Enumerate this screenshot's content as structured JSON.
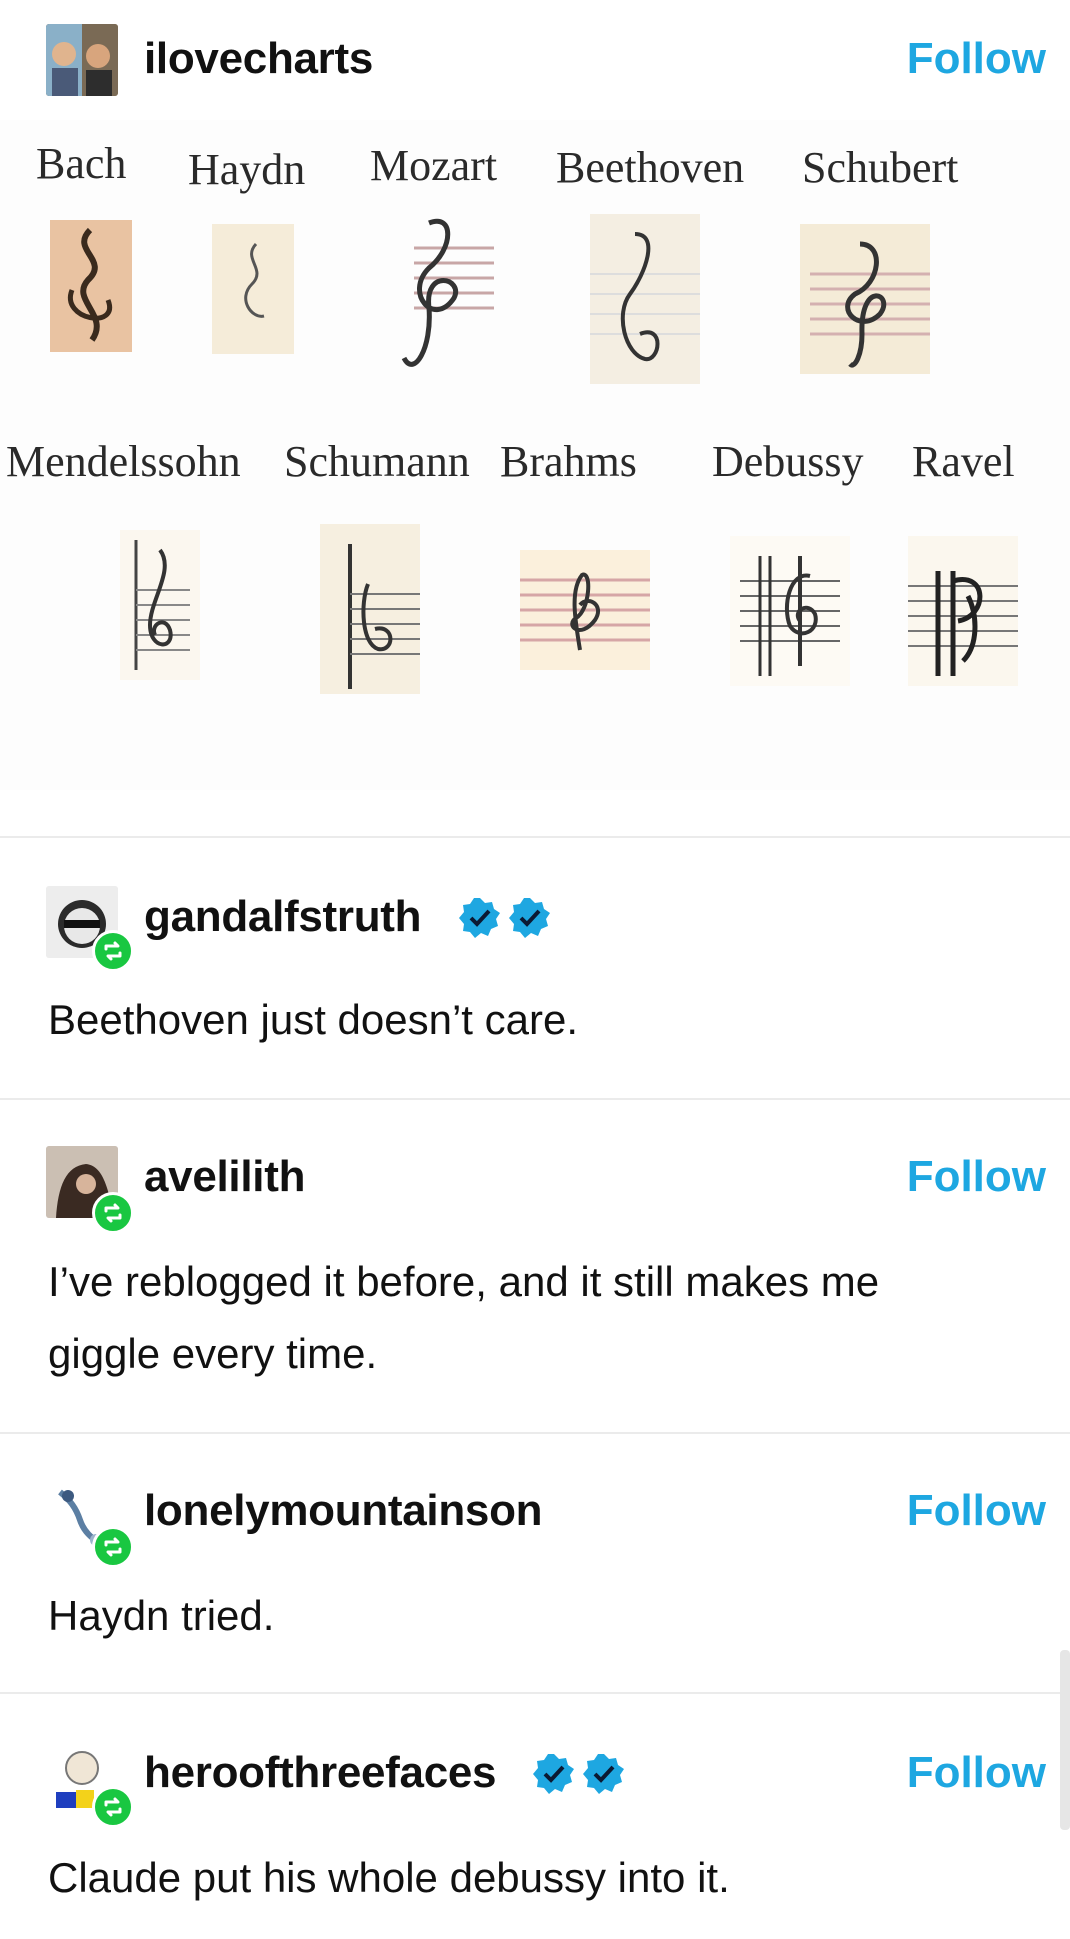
{
  "post": {
    "author": "ilovecharts",
    "follow_label": "Follow",
    "figure": {
      "row1": [
        "Bach",
        "Haydn",
        "Mozart",
        "Beethoven",
        "Schubert"
      ],
      "row2": [
        "Mendelssohn",
        "Schumann",
        "Brahms",
        "Debussy",
        "Ravel"
      ]
    }
  },
  "reblogs": [
    {
      "username": "gandalfstruth",
      "verified_badges": 2,
      "follow": false,
      "text_lines": [
        "Beethoven just doesn’t care."
      ]
    },
    {
      "username": "avelilith",
      "verified_badges": 0,
      "follow": true,
      "text_lines": [
        "I’ve reblogged it before, and it still makes me",
        "giggle every time."
      ]
    },
    {
      "username": "lonelymountainson",
      "verified_badges": 0,
      "follow": true,
      "text_lines": [
        "Haydn tried."
      ]
    },
    {
      "username": "heroofthreefaces",
      "verified_badges": 2,
      "follow": true,
      "text_lines": [
        "Claude put his whole debussy into it."
      ]
    }
  ],
  "colors": {
    "follow": "#1ea7e1",
    "reblog_badge": "#19c741",
    "verified": "#1ea7e1"
  }
}
